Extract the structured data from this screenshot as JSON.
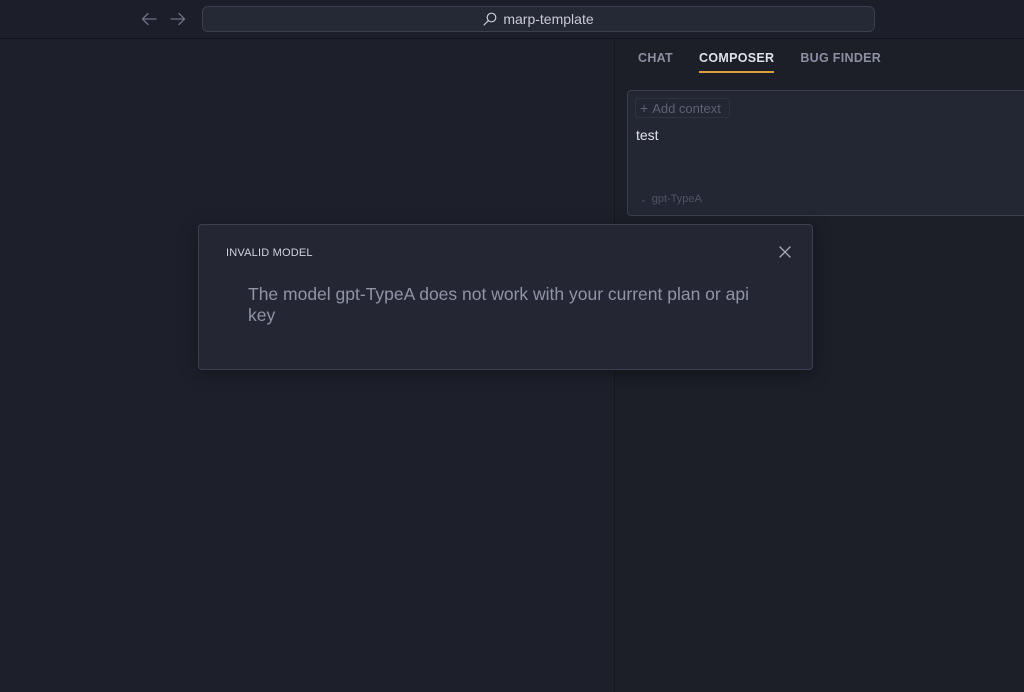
{
  "titlebar": {
    "search_text": "marp-template",
    "nav": {
      "back_icon": "arrow-left-icon",
      "forward_icon": "arrow-right-icon"
    }
  },
  "side_panel": {
    "tabs": [
      {
        "label": "CHAT",
        "active": false
      },
      {
        "label": "COMPOSER",
        "active": true
      },
      {
        "label": "BUG FINDER",
        "active": false
      }
    ],
    "composer": {
      "add_context_label": "Add context",
      "input_value": "test",
      "model_label": "gpt-TypeA"
    }
  },
  "modal": {
    "title": "INVALID MODEL",
    "message": "The model gpt-TypeA does not work with your current plan or api key"
  },
  "colors": {
    "accent": "#d9a13a",
    "background": "#1d202b",
    "panel": "#242733"
  }
}
